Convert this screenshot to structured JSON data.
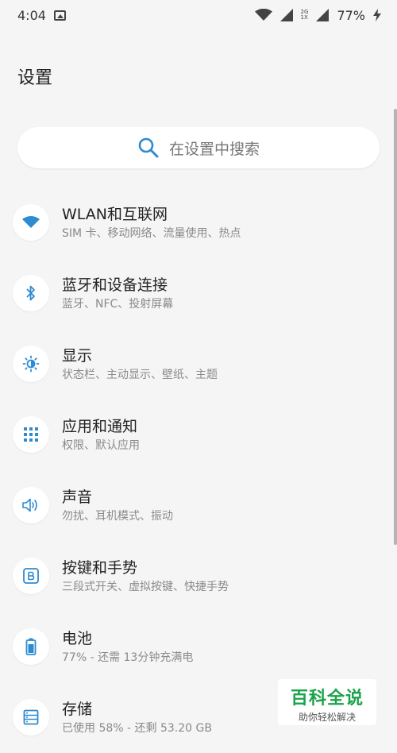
{
  "status_bar": {
    "time": "4:04",
    "net_top": "2G",
    "net_bottom": "1X",
    "battery": "77%"
  },
  "page": {
    "title": "设置"
  },
  "search": {
    "placeholder": "在设置中搜索"
  },
  "items": [
    {
      "title": "WLAN和互联网",
      "subtitle": "SIM 卡、移动网络、流量使用、热点",
      "icon": "wifi-icon"
    },
    {
      "title": "蓝牙和设备连接",
      "subtitle": "蓝牙、NFC、投射屏幕",
      "icon": "bluetooth-icon"
    },
    {
      "title": "显示",
      "subtitle": "状态栏、主动显示、壁纸、主题",
      "icon": "brightness-icon"
    },
    {
      "title": "应用和通知",
      "subtitle": "权限、默认应用",
      "icon": "apps-grid-icon"
    },
    {
      "title": "声音",
      "subtitle": "勿扰、耳机模式、振动",
      "icon": "speaker-icon"
    },
    {
      "title": "按键和手势",
      "subtitle": "三段式开关、虚拟按键、快捷手势",
      "icon": "button-b-icon"
    },
    {
      "title": "电池",
      "subtitle": "77% - 还需 13分钟充满电",
      "icon": "battery-icon"
    },
    {
      "title": "存储",
      "subtitle": "已使用 58% - 还剩 53.20 GB",
      "icon": "storage-icon"
    }
  ],
  "watermark": {
    "title": "百科全说",
    "subtitle": "助你轻松解决"
  },
  "colors": {
    "accent": "#2d8bd1",
    "background": "#f5f5f5",
    "watermark_green": "#1aa34a"
  }
}
